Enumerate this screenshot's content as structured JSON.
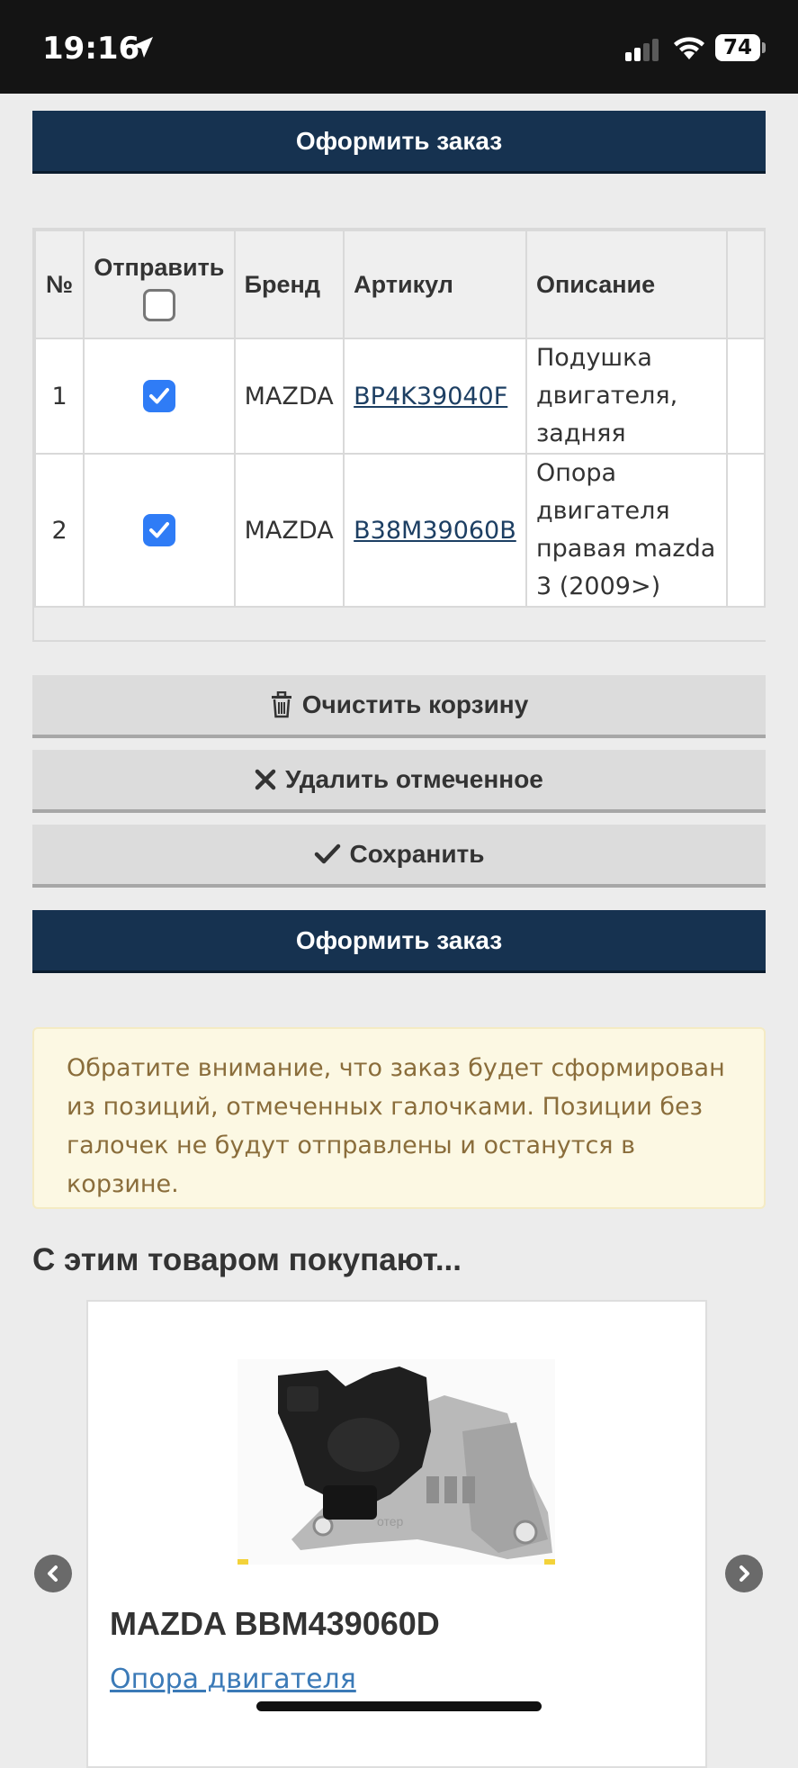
{
  "status_bar": {
    "time": "19:16",
    "battery": "74"
  },
  "checkout": {
    "label": "Оформить заказ"
  },
  "table": {
    "headers": {
      "num": "№",
      "send": "Отправить",
      "brand": "Бренд",
      "sku": "Артикул",
      "desc": "Описание"
    },
    "rows": [
      {
        "num": "1",
        "checked": true,
        "brand": "MAZDA",
        "sku": "BP4K39040F",
        "desc": "Подушка двигателя, задняя"
      },
      {
        "num": "2",
        "checked": true,
        "brand": "MAZDA",
        "sku": "B38M39060B",
        "desc": "Опора двигателя правая mazda 3 (2009>)"
      }
    ]
  },
  "actions": {
    "clear": "Очистить корзину",
    "delete": "Удалить отмеченное",
    "save": "Сохранить"
  },
  "notice": "Обратите внимание, что заказ будет сформирован из позиций, отмеченных галочками. Позиции без галочек не будут отправлены и останутся в корзине.",
  "related": {
    "title": "С этим товаром покупают...",
    "product_title": "MAZDA BBM439060D",
    "product_link": "Опора двигателя",
    "image_watermark": "отер"
  },
  "colors": {
    "primary": "#163250",
    "checkbox": "#2f7cf6",
    "notice_bg": "#fcf8e3",
    "notice_text": "#8a6d3b"
  }
}
